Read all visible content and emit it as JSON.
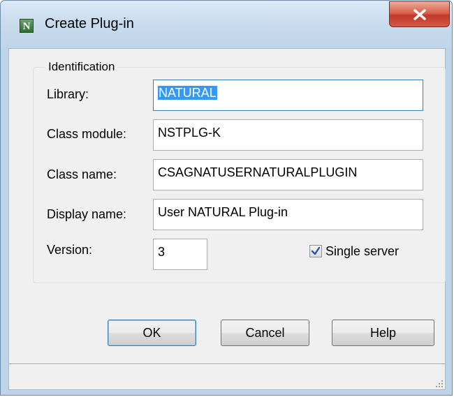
{
  "window": {
    "title": "Create Plug-in",
    "icon_letter": "N",
    "icon": "natural-app-icon"
  },
  "titlebar": {
    "close_icon": "close-icon"
  },
  "identification": {
    "group_label": "Identification",
    "library_label": "Library:",
    "library_value": "NATURAL",
    "class_module_label": "Class module:",
    "class_module_value": "NSTPLG-K",
    "class_name_label": "Class name:",
    "class_name_value": "CSAGNATUSERNATURALPLUGIN",
    "display_name_label": "Display name:",
    "display_name_value": "User NATURAL Plug-in",
    "version_label": "Version:",
    "version_value": "3",
    "single_server_label": "Single server",
    "single_server_checked": true
  },
  "buttons": {
    "ok": "OK",
    "cancel": "Cancel",
    "help": "Help"
  },
  "colors": {
    "selection": "#3399ff",
    "close_button": "#c1382a",
    "app_icon": "#2f6e33"
  }
}
